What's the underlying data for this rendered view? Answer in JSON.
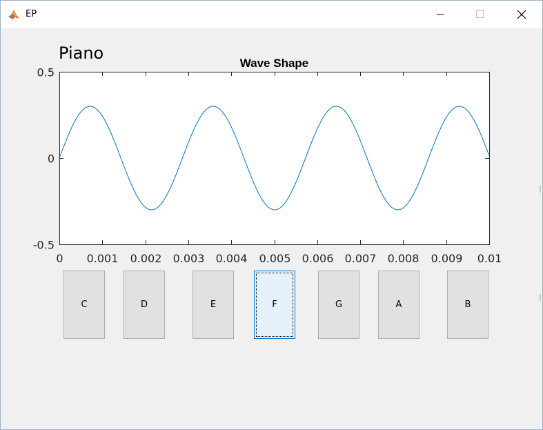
{
  "window": {
    "title": "EP",
    "controls": {
      "minimize": "minimize",
      "maximize": "maximize",
      "close": "close"
    }
  },
  "figure": {
    "label": "Piano"
  },
  "chart_data": {
    "type": "line",
    "title": "Wave Shape",
    "xlabel": "",
    "ylabel": "",
    "xlim": [
      0,
      0.01
    ],
    "ylim": [
      -0.5,
      0.5
    ],
    "xticks": [
      "0",
      "0.001",
      "0.002",
      "0.003",
      "0.004",
      "0.005",
      "0.006",
      "0.007",
      "0.008",
      "0.009",
      "0.01"
    ],
    "yticks": [
      "-0.5",
      "0",
      "0.5"
    ],
    "grid": false,
    "legend": "none",
    "series": [
      {
        "function": "0.3*sin(2*pi*349.23*x)",
        "amplitude": 0.3,
        "frequency_hz": 349.23,
        "color": "#0072bd"
      }
    ]
  },
  "keys": [
    {
      "label": "C"
    },
    {
      "label": "D"
    },
    {
      "label": "E"
    },
    {
      "label": "F",
      "focused": true
    },
    {
      "label": "G"
    },
    {
      "label": "A"
    },
    {
      "label": "B"
    }
  ]
}
